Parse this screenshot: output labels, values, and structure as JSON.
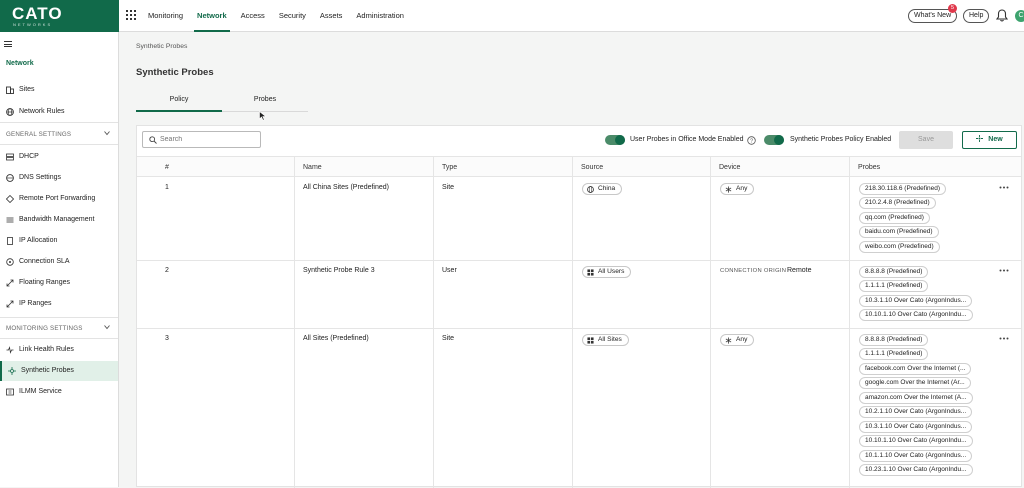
{
  "header": {
    "logo": "CATO",
    "logo_sub": "NETWORKS",
    "nav": [
      "Monitoring",
      "Network",
      "Access",
      "Security",
      "Assets",
      "Administration"
    ],
    "active_nav": "Network",
    "whats_new": "What's New",
    "whats_new_count": "5",
    "help": "Help",
    "avatar_initial": "C"
  },
  "sidebar": {
    "title": "Network",
    "items_top": [
      "Sites",
      "Network Rules"
    ],
    "section_general": "GENERAL SETTINGS",
    "items_general": [
      "DHCP",
      "DNS Settings",
      "Remote Port Forwarding",
      "Bandwidth Management",
      "IP Allocation",
      "Connection SLA",
      "Floating Ranges",
      "IP Ranges"
    ],
    "section_monitoring": "MONITORING SETTINGS",
    "items_monitoring": [
      "Link Health Rules",
      "Synthetic Probes",
      "ILMM Service"
    ],
    "active_item": "Synthetic Probes"
  },
  "page": {
    "breadcrumb": "Synthetic Probes",
    "title": "Synthetic Probes",
    "tabs": [
      "Policy",
      "Probes"
    ],
    "active_tab": "Policy"
  },
  "toolbar": {
    "search_placeholder": "Search",
    "toggle1_label": "User Probes in Office Mode Enabled",
    "toggle2_label": "Synthetic Probes Policy Enabled",
    "save": "Save",
    "new": "New"
  },
  "table": {
    "columns": [
      "#",
      "Name",
      "Type",
      "Source",
      "Device",
      "Probes"
    ],
    "rows": [
      {
        "num": "1",
        "name": "All China Sites (Predefined)",
        "type": "Site",
        "source": "China",
        "device": "Any",
        "conn_label": "",
        "probes": [
          "218.30.118.6 (Predefined)",
          "210.2.4.8 (Predefined)",
          "qq.com (Predefined)",
          "baidu.com (Predefined)",
          "weibo.com (Predefined)"
        ]
      },
      {
        "num": "2",
        "name": "Synthetic Probe Rule 3",
        "type": "User",
        "source": "All Users",
        "device": "Remote",
        "conn_label": "CONNECTION ORIGIN",
        "probes": [
          "8.8.8.8 (Predefined)",
          "1.1.1.1 (Predefined)",
          "10.3.1.10 Over Cato (ArgonIndus...",
          "10.10.1.10 Over Cato (ArgonIndu..."
        ]
      },
      {
        "num": "3",
        "name": "All Sites (Predefined)",
        "type": "Site",
        "source": "All Sites",
        "device": "Any",
        "conn_label": "",
        "probes": [
          "8.8.8.8 (Predefined)",
          "1.1.1.1 (Predefined)",
          "facebook.com Over the Internet (...",
          "google.com Over the Internet (Ar...",
          "amazon.com Over the Internet (A...",
          "10.2.1.10 Over Cato (ArgonIndus...",
          "10.3.1.10 Over Cato (ArgonIndus...",
          "10.10.1.10 Over Cato (ArgonIndu...",
          "10.1.1.10 Over Cato (ArgonIndus...",
          "10.23.1.10 Over Cato (ArgonIndu..."
        ]
      }
    ]
  },
  "colors": {
    "brand": "#116a4a",
    "active_bg": "#e1f0e8"
  }
}
